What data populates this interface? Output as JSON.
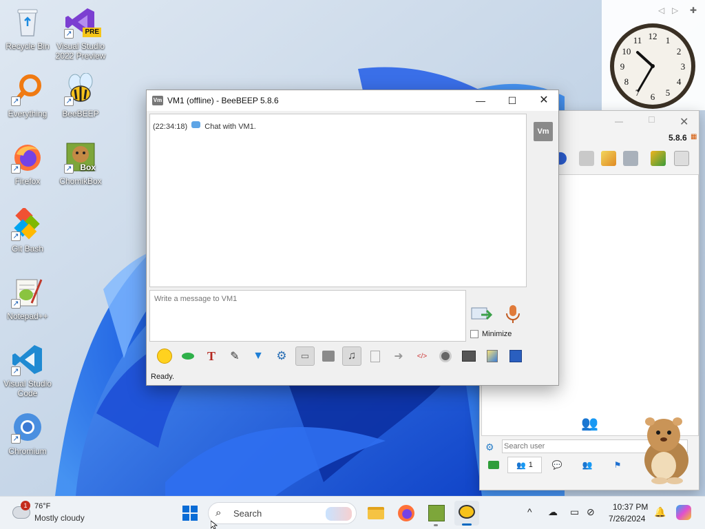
{
  "desktop": {
    "icons": [
      {
        "label": "Recycle Bin"
      },
      {
        "label": "Visual Studio 2022 Preview",
        "badge": "PRE"
      },
      {
        "label": "Everything"
      },
      {
        "label": "BeeBEEP"
      },
      {
        "label": "Firefox"
      },
      {
        "label": "ChomikBox",
        "badge": "Box"
      },
      {
        "label": "Git Bash"
      },
      {
        "label": "Notepad++"
      },
      {
        "label": "Visual Studio Code"
      },
      {
        "label": "Chromium"
      }
    ]
  },
  "clock_gadget": {
    "numbers": [
      "12",
      "1",
      "2",
      "3",
      "4",
      "5",
      "6",
      "7",
      "8",
      "9",
      "10",
      "11"
    ]
  },
  "main_window": {
    "version": "5.8.6",
    "search_placeholder": "Search user",
    "tabs": [
      {
        "label": "1"
      }
    ]
  },
  "chat_window": {
    "app_badge": "Vm",
    "title": "VM1 (offline) - BeeBEEP 5.8.6",
    "avatar_badge": "Vm",
    "history": {
      "timestamp": "(22:34:18)",
      "text": "Chat with VM1."
    },
    "input_placeholder": "Write a message to VM1",
    "minimize_label": "Minimize",
    "status": "Ready."
  },
  "taskbar": {
    "weather": {
      "temp": "76°F",
      "condition": "Mostly cloudy",
      "badge": "1"
    },
    "search_label": "Search",
    "time": "10:37 PM",
    "date": "7/26/2024"
  },
  "colors": {
    "accent": "#0067c0",
    "taskbar_bg": "#eef2f6"
  }
}
